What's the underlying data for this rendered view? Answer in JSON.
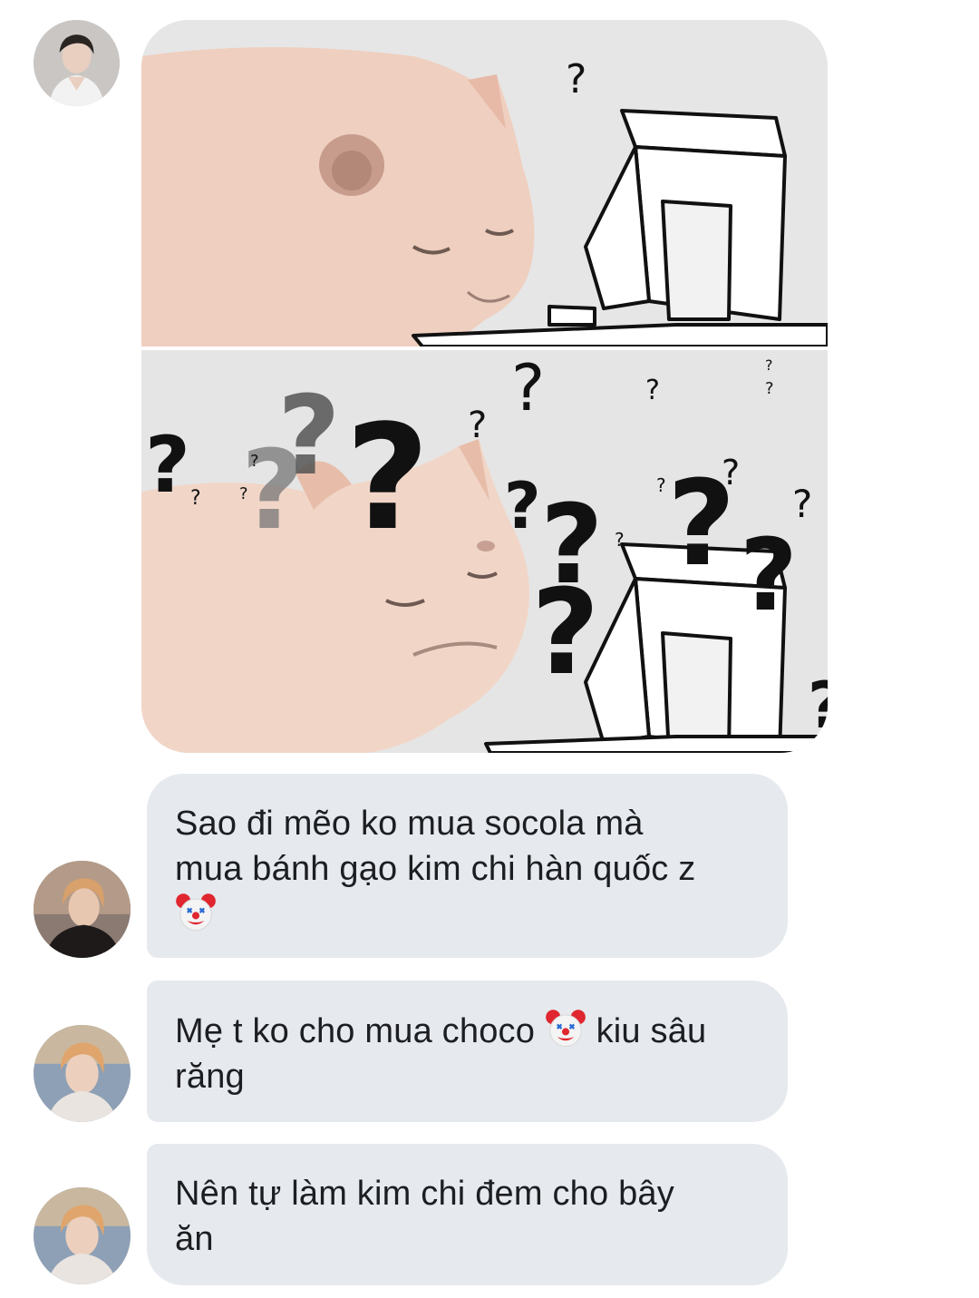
{
  "messages": [
    {
      "sender": "user-1",
      "type": "image",
      "image": {
        "panel_top": {
          "question_marks": [
            "?"
          ]
        },
        "panel_bottom": {
          "question_marks": [
            "?",
            "?",
            "?",
            "?",
            "?",
            "?",
            "?",
            "?",
            "?",
            "?",
            "?",
            "?",
            "?",
            "?",
            "?",
            "?",
            "?",
            "?",
            "?",
            "?",
            "?",
            "?"
          ]
        }
      }
    },
    {
      "sender": "user-2",
      "type": "text",
      "line1": "Sao đi mẽo ko mua socola mà",
      "line2": "mua bánh gạo kim chi hàn quốc z",
      "emoji": "clown-face-icon"
    },
    {
      "sender": "user-3",
      "type": "text",
      "line1_before": "Mẹ t ko cho mua choco",
      "emoji": "clown-face-icon",
      "line1_after": "kiu sâu",
      "line2": "răng"
    },
    {
      "sender": "user-3",
      "type": "text",
      "line1": "Nên tự làm kim chi đem cho bây",
      "line2": "ăn"
    }
  ],
  "colors": {
    "bubble": "#e6e9ee",
    "text": "#1c1e21",
    "background": "#ffffff"
  }
}
